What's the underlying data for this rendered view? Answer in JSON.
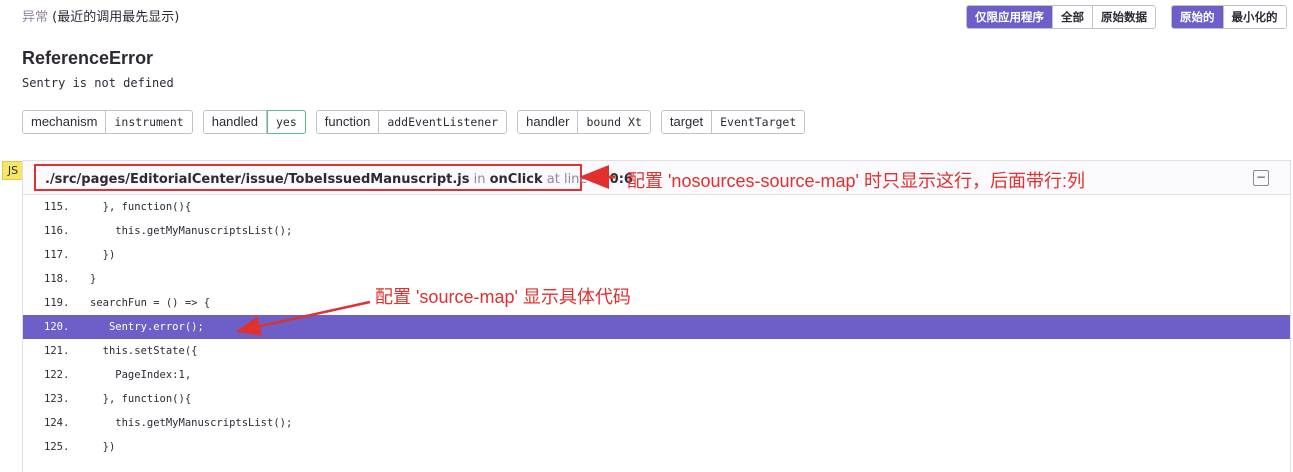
{
  "header": {
    "title_part1": "异常",
    "title_part2": "(最近的调用最先显示)"
  },
  "filter_buttons": [
    "仅限应用程序",
    "全部",
    "原始数据"
  ],
  "view_buttons": [
    "原始的",
    "最小化的"
  ],
  "exception": {
    "type": "ReferenceError",
    "message": "Sentry is not defined"
  },
  "tags": [
    {
      "key": "mechanism",
      "value": "instrument"
    },
    {
      "key": "handled",
      "value": "yes"
    },
    {
      "key": "function",
      "value": "addEventListener"
    },
    {
      "key": "handler",
      "value": "bound Xt"
    },
    {
      "key": "target",
      "value": "EventTarget"
    }
  ],
  "frame": {
    "platform": "JS",
    "file": "./src/pages/EditorialCenter/issue/TobeIssuedManuscript.js",
    "in_label": "in",
    "function": "onClick",
    "at_line_label": "at line",
    "location": "120:6",
    "collapse_symbol": "−",
    "lines": [
      {
        "no": "115.",
        "code": "  }, function(){"
      },
      {
        "no": "116.",
        "code": "    this.getMyManuscriptsList();"
      },
      {
        "no": "117.",
        "code": "  })"
      },
      {
        "no": "118.",
        "code": "}"
      },
      {
        "no": "119.",
        "code": "searchFun = () => {"
      },
      {
        "no": "120.",
        "code": "   Sentry.error();"
      },
      {
        "no": "121.",
        "code": "  this.setState({"
      },
      {
        "no": "122.",
        "code": "    PageIndex:1,"
      },
      {
        "no": "123.",
        "code": "  }, function(){"
      },
      {
        "no": "124.",
        "code": "    this.getMyManuscriptsList();"
      },
      {
        "no": "125.",
        "code": "  })"
      }
    ],
    "highlighted_line": "120."
  },
  "annotations": {
    "nosources": "配置 'nosources-source-map' 时只显示这行，后面带行:列",
    "source_map": "配置 'source-map' 显示具体代码"
  },
  "colors": {
    "accent": "#6c5fc7",
    "annotation_red": "#e03030",
    "js_badge": "#f7e565",
    "handled_green": "#57be8c"
  }
}
